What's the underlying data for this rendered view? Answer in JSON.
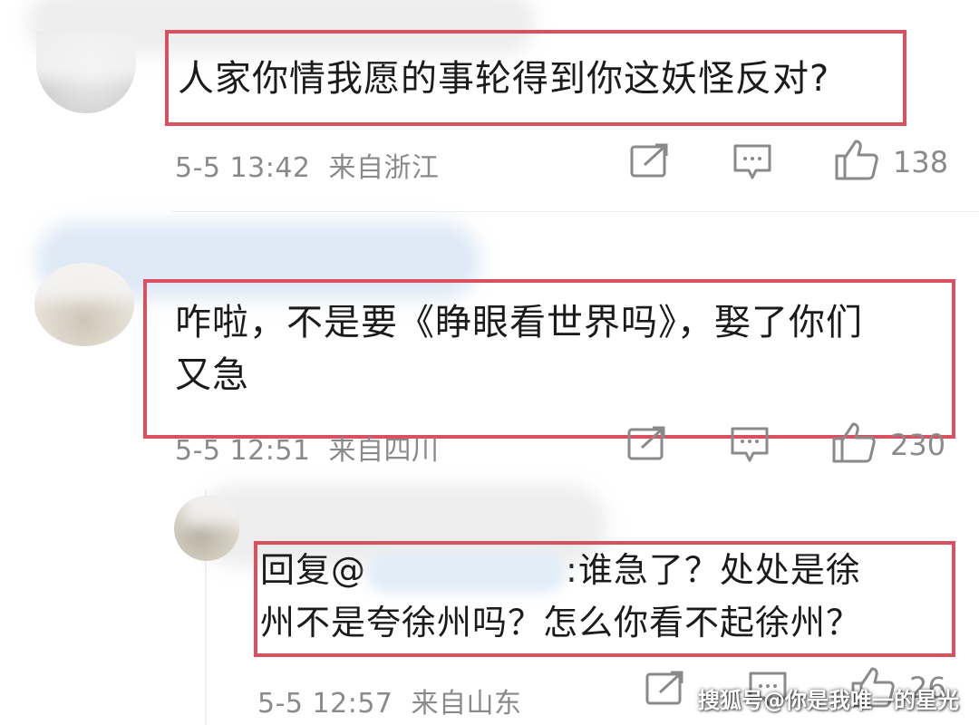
{
  "comments": [
    {
      "text": "人家你情我愿的事轮得到你这妖怪反对?",
      "time": "5-5 13:42",
      "location": "来自浙江",
      "likes": "138"
    },
    {
      "text_line1": "咋啦，不是要《睁眼看世界吗》，娶了你们",
      "text_line2": "又急",
      "time": "5-5 12:51",
      "location": "来自四川",
      "likes": "230"
    },
    {
      "reply_prefix": "回复@",
      "text_line1_tail": ":谁急了？处处是徐",
      "text_line2": "州不是夸徐州吗？怎么你看不起徐州？",
      "time": "5-5 12:57",
      "location": "来自山东",
      "likes": "26"
    }
  ],
  "watermark": "搜狐号@你是我唯一的星光",
  "icons": {
    "share": "share-icon",
    "comment": "comment-icon",
    "like": "thumbs-up-icon"
  },
  "colors": {
    "highlight": "#d9505e",
    "meta_text": "#8a8a8a"
  }
}
